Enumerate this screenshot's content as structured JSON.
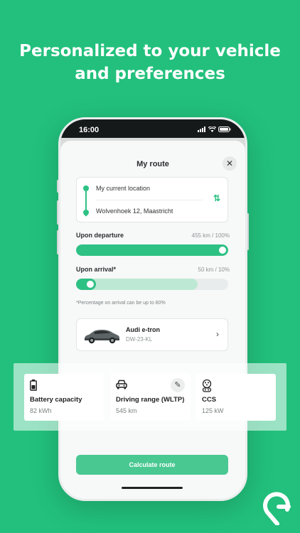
{
  "headline": {
    "line1": "Personalized to your vehicle",
    "line2": "and preferences"
  },
  "status_bar": {
    "time": "16:00"
  },
  "sheet": {
    "title": "My route",
    "close_icon": "close-icon"
  },
  "route": {
    "from": "My current location",
    "to": "Wolvenhoek 12, Maastricht",
    "swap_icon": "swap-icon"
  },
  "departure": {
    "label": "Upon departure",
    "value": "455 km / 100%",
    "level_percent": 100
  },
  "arrival": {
    "label": "Upon arrival*",
    "value": "50 km / 10%",
    "level_percent": 10,
    "max_percent": 80
  },
  "note": "*Percentage on arrival can be up to 80%",
  "vehicle": {
    "name": "Audi e-tron",
    "plate": "DW-23-KL"
  },
  "specs": [
    {
      "title": "Battery capacity",
      "value": "82 kWh",
      "icon": "battery-icon"
    },
    {
      "title": "Driving range (WLTP)",
      "value": "545 km",
      "icon": "car-icon"
    },
    {
      "title": "CCS",
      "value": "125 kW",
      "icon": "ccs-plug-icon"
    }
  ],
  "cta": {
    "label": "Calculate route"
  },
  "colors": {
    "background": "#22c07c",
    "accent": "#2ec184",
    "accent_light": "#bde9d4",
    "button": "#49c892"
  }
}
